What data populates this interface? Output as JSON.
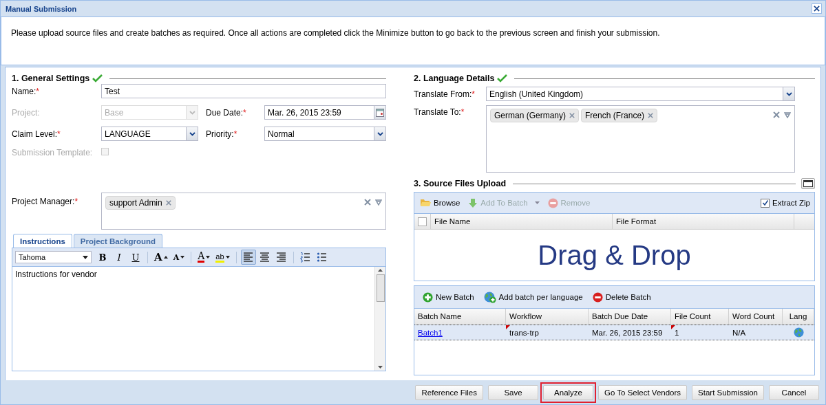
{
  "window": {
    "title": "Manual Submission"
  },
  "intro": "Please upload source files and create batches as required. Once all actions are completed click the Minimize button to go back to the previous screen and finish your submission.",
  "general_settings": {
    "title": "1. General Settings",
    "complete": true
  },
  "name": {
    "label": "Name:",
    "required_mark": "*",
    "value": "Test"
  },
  "project": {
    "label": "Project:",
    "disabled": true,
    "value": "Base"
  },
  "due_date": {
    "label": "Due Date:",
    "required_mark": "*",
    "value": "Mar. 26, 2015 23:59"
  },
  "claim_level": {
    "label": "Claim Level:",
    "required_mark": "*",
    "value": "LANGUAGE",
    "disabled": false
  },
  "priority": {
    "label": "Priority:",
    "required_mark": "*",
    "value": "Normal",
    "disabled": false
  },
  "submission_template": {
    "label": "Submission Template:",
    "disabled": true,
    "checked": false
  },
  "project_manager": {
    "label": "Project Manager:",
    "required_mark": "*",
    "tags": [
      "support Admin"
    ]
  },
  "tabs": [
    {
      "label": "Instructions",
      "selected": true
    },
    {
      "label": "Project Background",
      "selected": false
    }
  ],
  "editor": {
    "font": "Tahoma",
    "text": "Instructions for vendor",
    "toolbar_groups": [
      [
        {
          "kind": "bold",
          "glyph": "B"
        },
        {
          "kind": "italic",
          "glyph": "I"
        },
        {
          "kind": "underline",
          "glyph": "U"
        }
      ],
      [
        {
          "kind": "grow",
          "glyph": "A"
        },
        {
          "kind": "shrink",
          "glyph": "A"
        }
      ],
      [
        {
          "kind": "color",
          "glyph": "A"
        },
        {
          "kind": "highlight",
          "glyph": "ab"
        }
      ],
      [
        {
          "kind": "align-left",
          "selected": true
        },
        {
          "kind": "align-center",
          "selected": false
        },
        {
          "kind": "align-right",
          "selected": false
        }
      ],
      [
        {
          "kind": "ordered-list"
        },
        {
          "kind": "bullet-list"
        }
      ]
    ]
  },
  "language_details": {
    "title": "2. Language Details",
    "complete": true
  },
  "translate_from": {
    "label": "Translate From:",
    "required_mark": "*",
    "value": "English (United Kingdom)"
  },
  "translate_to": {
    "label": "Translate To:",
    "required_mark": "*",
    "tags": [
      "German (Germany)",
      "French (France)"
    ]
  },
  "source_files": {
    "title": "3. Source Files Upload",
    "toolbar": [
      {
        "kind": "browse",
        "label": "Browse",
        "disabled": false,
        "menu": false
      },
      {
        "kind": "add",
        "label": "Add To Batch",
        "disabled": true,
        "menu": true
      },
      {
        "kind": "remove",
        "label": "Remove",
        "disabled": true,
        "menu": false
      }
    ],
    "extract_zip": {
      "label": "Extract Zip",
      "checked": true
    },
    "select_all_checked": false,
    "columns": [
      "File Name",
      "File Format"
    ],
    "drop_text": "Drag & Drop"
  },
  "batches": {
    "toolbar": [
      {
        "kind": "new",
        "label": "New Batch"
      },
      {
        "kind": "per-language",
        "label": "Add batch per language"
      },
      {
        "kind": "delete",
        "label": "Delete Batch"
      }
    ],
    "columns": [
      "Batch Name",
      "Workflow",
      "Batch Due Date",
      "File Count",
      "Word Count",
      "Lang"
    ],
    "rows": [
      {
        "selected": true,
        "cells": [
          {
            "kind": "link",
            "text": "Batch1",
            "edited": false
          },
          {
            "kind": "text",
            "text": "trans-trp",
            "edited": true
          },
          {
            "kind": "text",
            "text": "Mar. 26, 2015 23:59",
            "edited": false
          },
          {
            "kind": "text",
            "text": "1",
            "edited": true
          },
          {
            "kind": "text",
            "text": "N/A",
            "edited": false
          },
          {
            "kind": "globe",
            "edited": false
          }
        ]
      }
    ]
  },
  "footer": {
    "buttons": [
      {
        "label": "Reference Files",
        "highlighted": false
      },
      {
        "label": "Save",
        "highlighted": false
      },
      {
        "label": "Analyze",
        "highlighted": true
      },
      {
        "label": "Go To Select Vendors",
        "highlighted": false
      },
      {
        "label": "Start Submission",
        "highlighted": false
      },
      {
        "label": "Cancel",
        "highlighted": false
      }
    ]
  }
}
